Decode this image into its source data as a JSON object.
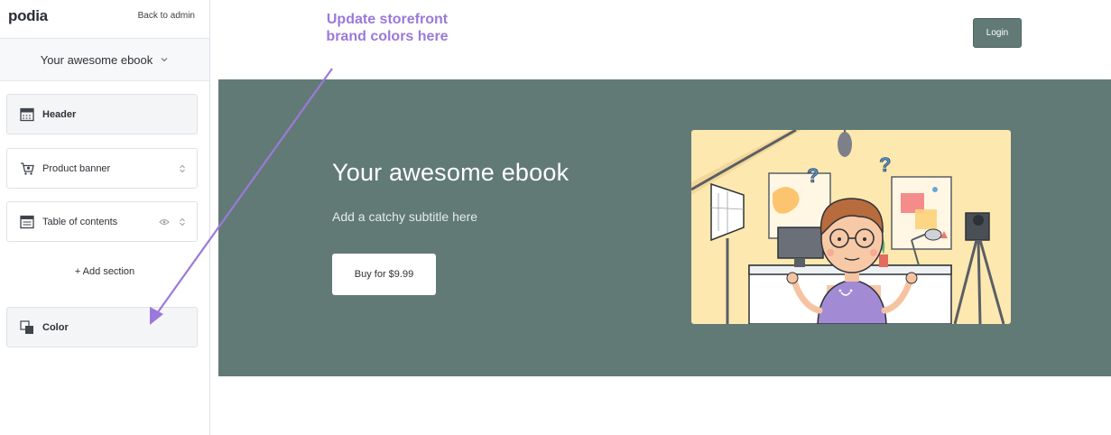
{
  "sidebar": {
    "logo": "podia",
    "back_link": "Back to admin",
    "site_selector": "Your awesome ebook",
    "sections": [
      {
        "label": "Header",
        "bold": true,
        "icon": "header-section-icon"
      },
      {
        "label": "Product banner",
        "bold": false,
        "icon": "cart-icon",
        "tools": [
          "reorder-icon"
        ]
      },
      {
        "label": "Table of contents",
        "bold": false,
        "icon": "list-section-icon",
        "tools": [
          "eye-icon",
          "reorder-icon"
        ]
      }
    ],
    "add_section": "+ Add section",
    "color_section": {
      "label": "Color",
      "icon": "color-swatch-icon"
    }
  },
  "preview": {
    "login_label": "Login",
    "hero": {
      "title": "Your awesome ebook",
      "subtitle": "Add a catchy subtitle here",
      "buy_label": "Buy for $9.99"
    }
  },
  "annotation": {
    "text": "Update storefront brand colors here",
    "color": "#9b79da"
  },
  "colors": {
    "brand": "#617a76",
    "accent_annotation": "#9b79da"
  }
}
